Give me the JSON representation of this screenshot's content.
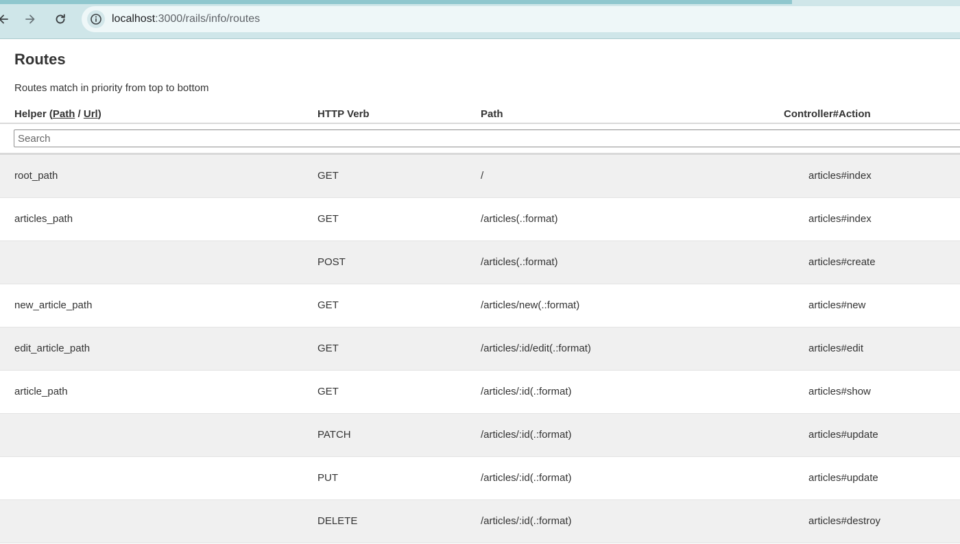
{
  "browser": {
    "url_host": "localhost",
    "url_rest": ":3000/rails/info/routes"
  },
  "page": {
    "title": "Routes",
    "subtitle": "Routes match in priority from top to bottom"
  },
  "table": {
    "headers": {
      "helper_prefix": "Helper (",
      "helper_path_link": "Path",
      "helper_sep": " / ",
      "helper_url_link": "Url",
      "helper_suffix": ")",
      "verb": "HTTP Verb",
      "path": "Path",
      "action": "Controller#Action"
    },
    "search_placeholder": "Search",
    "rows": [
      {
        "helper": "root_path",
        "verb": "GET",
        "path": "/",
        "action": "articles#index"
      },
      {
        "helper": "articles_path",
        "verb": "GET",
        "path": "/articles(.:format)",
        "action": "articles#index"
      },
      {
        "helper": "",
        "verb": "POST",
        "path": "/articles(.:format)",
        "action": "articles#create"
      },
      {
        "helper": "new_article_path",
        "verb": "GET",
        "path": "/articles/new(.:format)",
        "action": "articles#new"
      },
      {
        "helper": "edit_article_path",
        "verb": "GET",
        "path": "/articles/:id/edit(.:format)",
        "action": "articles#edit"
      },
      {
        "helper": "article_path",
        "verb": "GET",
        "path": "/articles/:id(.:format)",
        "action": "articles#show"
      },
      {
        "helper": "",
        "verb": "PATCH",
        "path": "/articles/:id(.:format)",
        "action": "articles#update"
      },
      {
        "helper": "",
        "verb": "PUT",
        "path": "/articles/:id(.:format)",
        "action": "articles#update"
      },
      {
        "helper": "",
        "verb": "DELETE",
        "path": "/articles/:id(.:format)",
        "action": "articles#destroy"
      }
    ]
  }
}
